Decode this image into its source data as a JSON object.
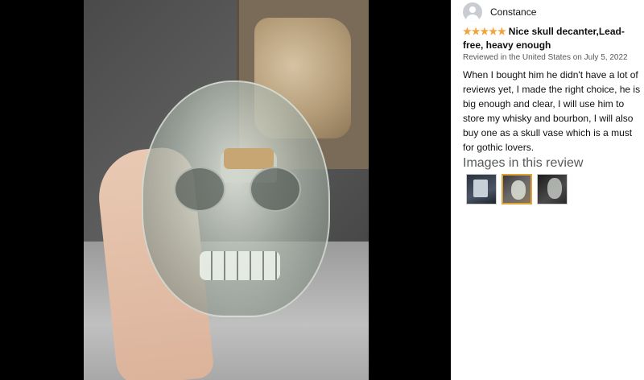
{
  "review": {
    "author": "Constance",
    "rating_stars": "★★★★★",
    "title": "Nice skull decanter,Lead-free, heavy enough",
    "reviewed_line": "Reviewed in the United States on July 5, 2022",
    "body": "When I bought him he didn't have a lot of reviews yet, I made the right choice, he is big enough and clear, I will use him to store my whisky and bourbon, I will also buy one as a skull vase which is a must for gothic lovers.",
    "images_heading": "Images in this review",
    "thumbnails": [
      {
        "icon": "review-image-1"
      },
      {
        "icon": "review-image-2",
        "selected": true
      },
      {
        "icon": "review-image-3"
      }
    ]
  },
  "colors": {
    "star": "#f2a33a",
    "selected_border": "#e3a33c",
    "text": "#0f1111",
    "muted": "#565959"
  }
}
